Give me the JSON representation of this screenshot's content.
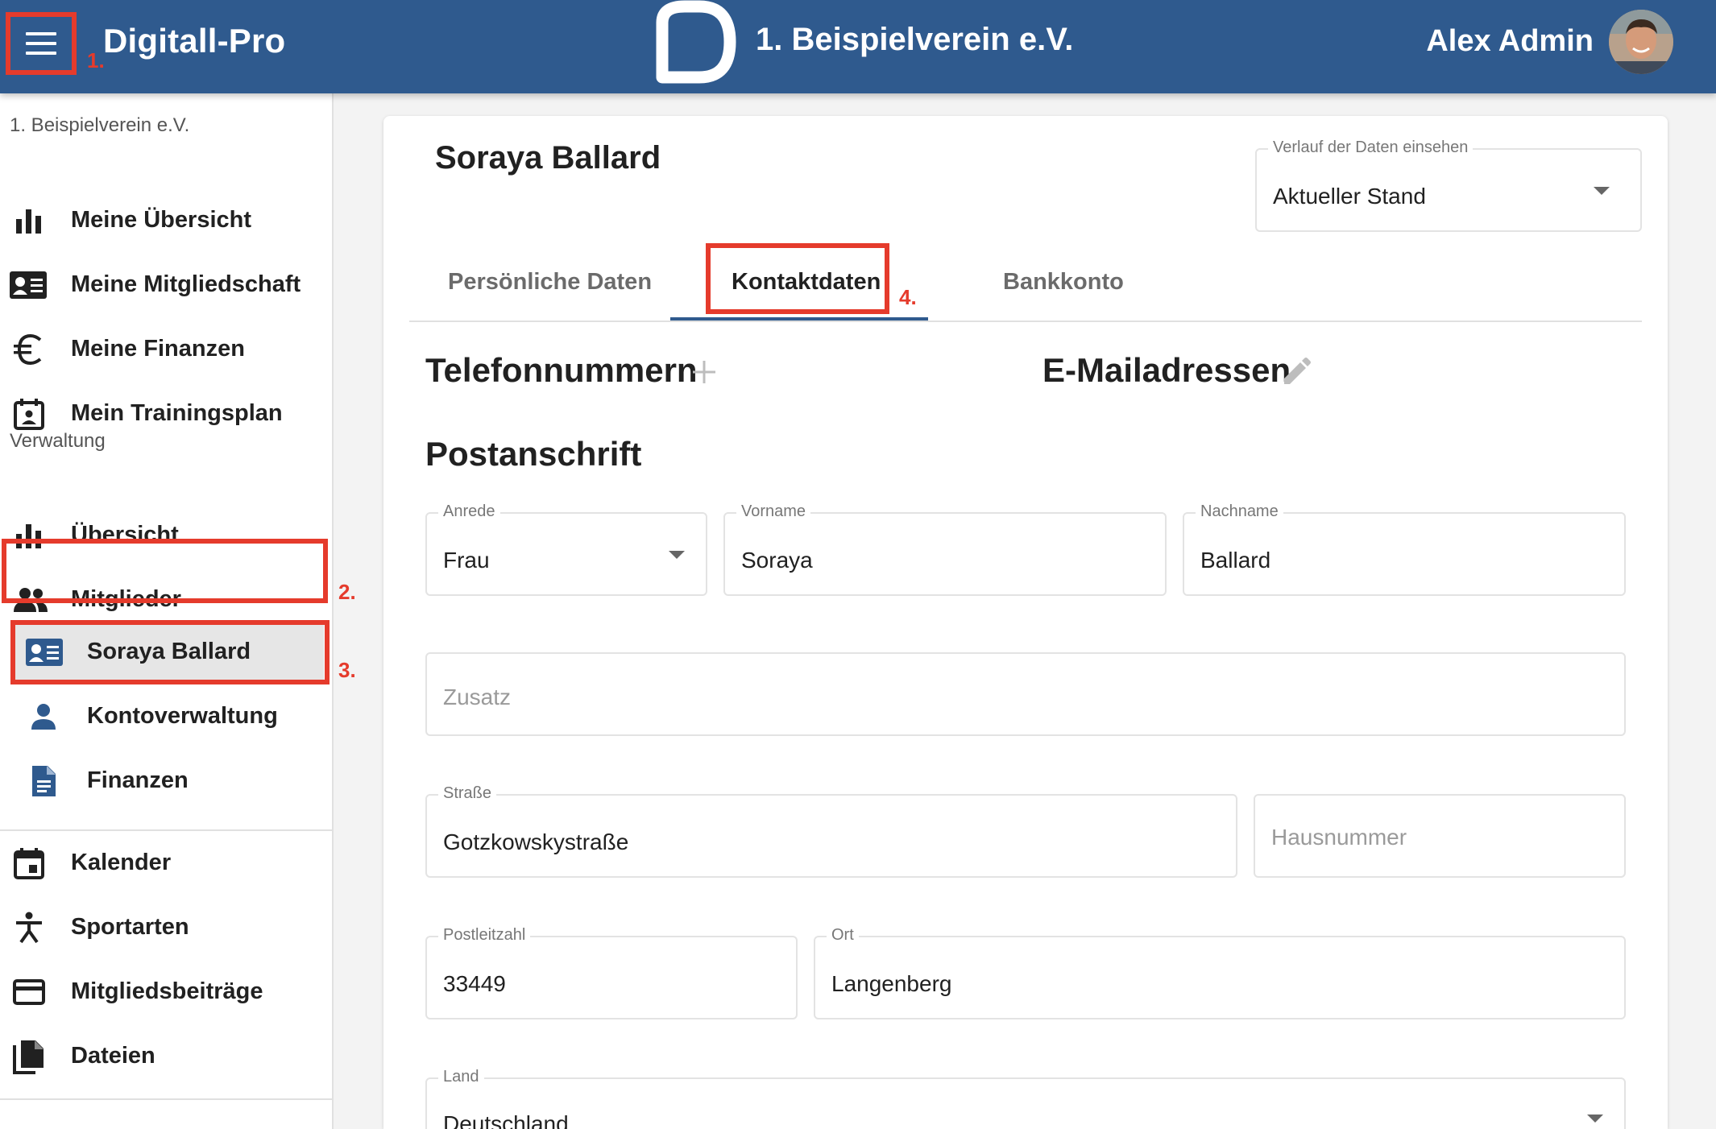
{
  "header": {
    "app_name": "Digitall-Pro",
    "club_title": "1. Beispielverein e.V.",
    "user_name": "Alex Admin",
    "marker": "1."
  },
  "sidebar": {
    "club_label": "1. Beispielverein e.V.",
    "personal_items": [
      {
        "label": "Meine Übersicht",
        "icon": "bar-chart-icon"
      },
      {
        "label": "Meine Mitgliedschaft",
        "icon": "id-card-icon"
      },
      {
        "label": "Meine Finanzen",
        "icon": "euro-icon"
      },
      {
        "label": "Mein Trainingsplan",
        "icon": "calendar-person-icon"
      }
    ],
    "admin_section": "Verwaltung",
    "admin_items": [
      {
        "label": "Übersicht",
        "icon": "bar-chart-icon"
      },
      {
        "label": "Mitglieder",
        "icon": "people-icon",
        "marker": "2."
      }
    ],
    "member_sub_items": [
      {
        "label": "Soraya Ballard",
        "icon": "id-card-icon",
        "marker": "3."
      },
      {
        "label": "Kontoverwaltung",
        "icon": "person-icon"
      },
      {
        "label": "Finanzen",
        "icon": "document-icon"
      }
    ],
    "general_items": [
      {
        "label": "Kalender",
        "icon": "calendar-icon"
      },
      {
        "label": "Sportarten",
        "icon": "sport-figure-icon"
      },
      {
        "label": "Mitgliedsbeiträge",
        "icon": "credit-card-icon"
      },
      {
        "label": "Dateien",
        "icon": "files-icon"
      }
    ]
  },
  "main": {
    "person_name": "Soraya Ballard",
    "history": {
      "label": "Verlauf der Daten einsehen",
      "value": "Aktueller Stand"
    },
    "tabs": [
      {
        "label": "Persönliche Daten"
      },
      {
        "label": "Kontaktdaten",
        "active": true,
        "marker": "4."
      },
      {
        "label": "Bankkonto"
      }
    ],
    "phones_title": "Telefonnummern",
    "emails_title": "E-Mailadressen",
    "postal_title": "Postanschrift",
    "fields": {
      "anrede": {
        "label": "Anrede",
        "value": "Frau"
      },
      "vorname": {
        "label": "Vorname",
        "value": "Soraya"
      },
      "nachname": {
        "label": "Nachname",
        "value": "Ballard"
      },
      "zusatz": {
        "placeholder": "Zusatz"
      },
      "strasse": {
        "label": "Straße",
        "value": "Gotzkowskystraße"
      },
      "hausnummer": {
        "placeholder": "Hausnummer"
      },
      "plz": {
        "label": "Postleitzahl",
        "value": "33449"
      },
      "ort": {
        "label": "Ort",
        "value": "Langenberg"
      },
      "land": {
        "label": "Land",
        "value": "Deutschland"
      }
    }
  },
  "colors": {
    "header_bg": "#2f5a8e",
    "highlight": "#e53b2c",
    "accent": "#2f5a8e"
  }
}
